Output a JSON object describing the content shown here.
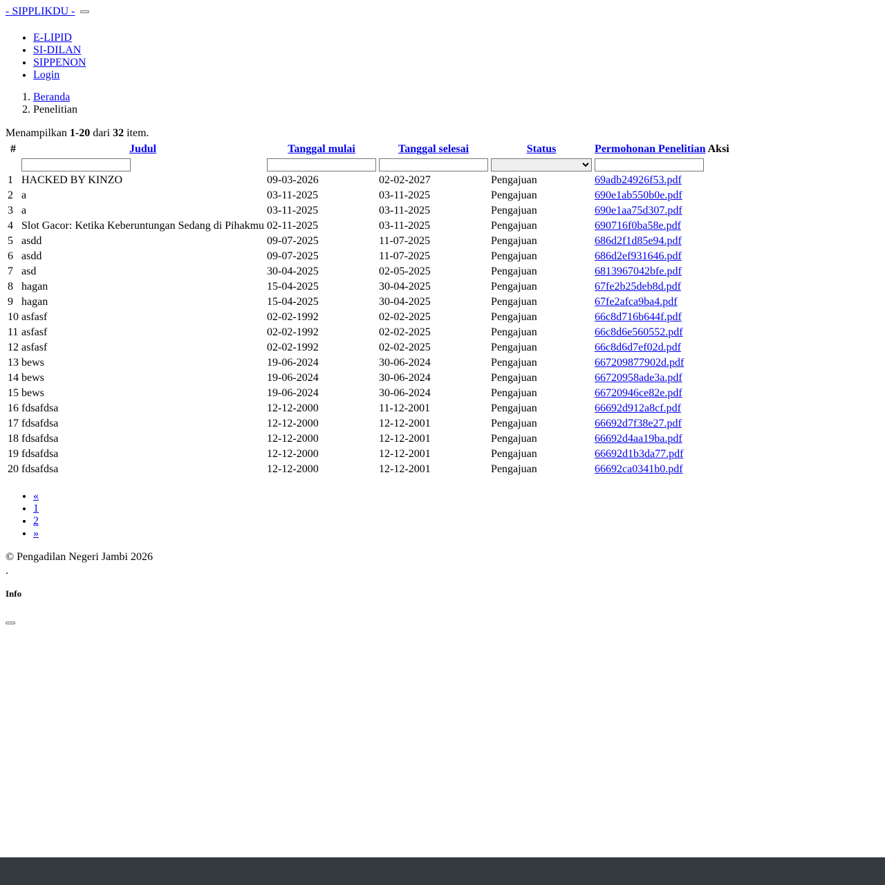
{
  "brand": "- SIPPLIKDU -",
  "nav": [
    "E-LIPID",
    "SI-DILAN",
    "SIPPENON",
    "Login"
  ],
  "breadcrumb": {
    "home": "Beranda",
    "current": "Penelitian"
  },
  "summary": {
    "prefix": "Menampilkan ",
    "range": "1-20",
    "middle": " dari ",
    "total": "32",
    "suffix": " item."
  },
  "table": {
    "headers": {
      "num": "#",
      "judul": "Judul",
      "mulai": "Tanggal mulai",
      "selesai": "Tanggal selesai",
      "status": "Status",
      "permohonan": "Permohonan Penelitian",
      "aksi": "Aksi"
    },
    "filters": {
      "judul": "",
      "mulai": "",
      "selesai": "",
      "status": "",
      "permohonan": ""
    },
    "rows": [
      [
        "1",
        "HACKED BY KINZO",
        "09-03-2026",
        "02-02-2027",
        "Pengajuan",
        "69adb24926f53.pdf"
      ],
      [
        "2",
        "a",
        "03-11-2025",
        "03-11-2025",
        "Pengajuan",
        "690e1ab550b0e.pdf"
      ],
      [
        "3",
        "a",
        "03-11-2025",
        "03-11-2025",
        "Pengajuan",
        "690e1aa75d307.pdf"
      ],
      [
        "4",
        "Slot Gacor: Ketika Keberuntungan Sedang di Pihakmu",
        "02-11-2025",
        "03-11-2025",
        "Pengajuan",
        "690716f0ba58e.pdf"
      ],
      [
        "5",
        "asdd",
        "09-07-2025",
        "11-07-2025",
        "Pengajuan",
        "686d2f1d85e94.pdf"
      ],
      [
        "6",
        "asdd",
        "09-07-2025",
        "11-07-2025",
        "Pengajuan",
        "686d2ef931646.pdf"
      ],
      [
        "7",
        "asd",
        "30-04-2025",
        "02-05-2025",
        "Pengajuan",
        "6813967042bfe.pdf"
      ],
      [
        "8",
        "hagan",
        "15-04-2025",
        "30-04-2025",
        "Pengajuan",
        "67fe2b25deb8d.pdf"
      ],
      [
        "9",
        "hagan",
        "15-04-2025",
        "30-04-2025",
        "Pengajuan",
        "67fe2afca9ba4.pdf"
      ],
      [
        "10",
        "asfasf",
        "02-02-1992",
        "02-02-2025",
        "Pengajuan",
        "66c8d716b644f.pdf"
      ],
      [
        "11",
        "asfasf",
        "02-02-1992",
        "02-02-2025",
        "Pengajuan",
        "66c8d6e560552.pdf"
      ],
      [
        "12",
        "asfasf",
        "02-02-1992",
        "02-02-2025",
        "Pengajuan",
        "66c8d6d7ef02d.pdf"
      ],
      [
        "13",
        "bews",
        "19-06-2024",
        "30-06-2024",
        "Pengajuan",
        "667209877902d.pdf"
      ],
      [
        "14",
        "bews",
        "19-06-2024",
        "30-06-2024",
        "Pengajuan",
        "66720958ade3a.pdf"
      ],
      [
        "15",
        "bews",
        "19-06-2024",
        "30-06-2024",
        "Pengajuan",
        "66720946ce82e.pdf"
      ],
      [
        "16",
        "fdsafdsa",
        "12-12-2000",
        "11-12-2001",
        "Pengajuan",
        "66692d912a8cf.pdf"
      ],
      [
        "17",
        "fdsafdsa",
        "12-12-2000",
        "12-12-2001",
        "Pengajuan",
        "66692d7f38e27.pdf"
      ],
      [
        "18",
        "fdsafdsa",
        "12-12-2000",
        "12-12-2001",
        "Pengajuan",
        "66692d4aa19ba.pdf"
      ],
      [
        "19",
        "fdsafdsa",
        "12-12-2000",
        "12-12-2001",
        "Pengajuan",
        "66692d1b3da77.pdf"
      ],
      [
        "20",
        "fdsafdsa",
        "12-12-2000",
        "12-12-2001",
        "Pengajuan",
        "66692ca0341b0.pdf"
      ]
    ]
  },
  "pagination": [
    "«",
    "1",
    "2",
    "»"
  ],
  "footer": {
    "copyright": "© Pengadilan Negeri Jambi 2026",
    "dot": "."
  },
  "modal": {
    "title": "Info"
  },
  "colors": {
    "link": "#0000ee",
    "bottom_bar": "#343a40"
  }
}
